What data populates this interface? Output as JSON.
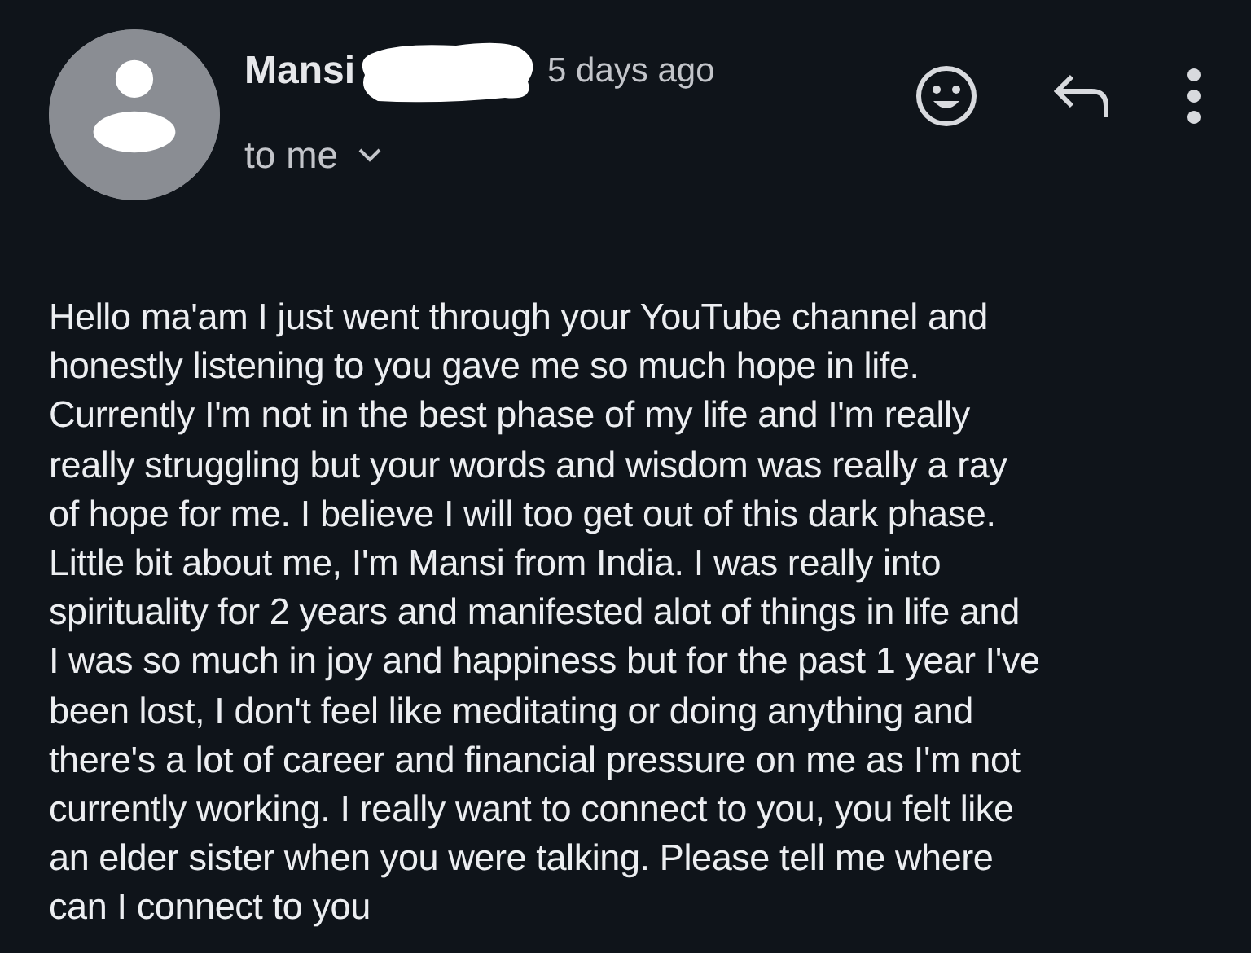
{
  "sender": {
    "name": "Mansi",
    "time": "5 days ago",
    "recipient": "to me"
  },
  "message": {
    "lines": [
      "Hello ma'am I just went through your YouTube channel and",
      "honestly listening to you gave me so much hope in life.",
      "Currently I'm not in the best phase of my life and I'm really",
      "really struggling but your words and wisdom was really a ray",
      "of hope for me. I believe I will too get out of this dark phase.",
      "Little bit about me, I'm Mansi from India. I was really into",
      "spirituality for 2 years and manifested alot of things in life and",
      "I was so much in joy and happiness but for the past 1 year I've",
      "been lost, I don't feel like meditating or doing anything and",
      "there's a lot of career and financial pressure on me as I'm not",
      "currently working. I really want to connect to you, you felt like",
      "an elder sister when you were talking. Please tell me where",
      "can I connect to you"
    ]
  }
}
